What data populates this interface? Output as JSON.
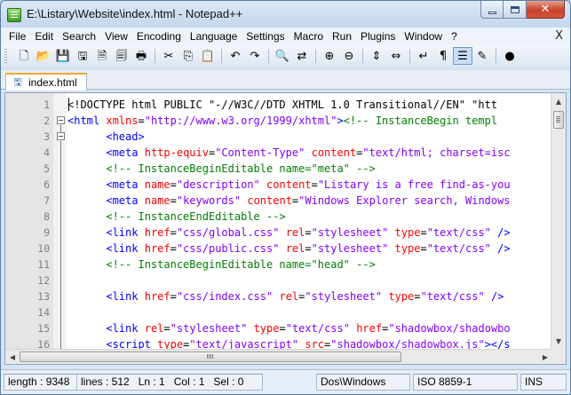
{
  "window": {
    "title": "E:\\Listary\\Website\\index.html - Notepad++"
  },
  "menu": {
    "items": [
      "File",
      "Edit",
      "Search",
      "View",
      "Encoding",
      "Language",
      "Settings",
      "Macro",
      "Run",
      "Plugins",
      "Window",
      "?"
    ],
    "close_glyph": "X"
  },
  "toolbar": {
    "buttons": [
      {
        "icon": "new-file-icon",
        "glyph": "🗋"
      },
      {
        "icon": "open-file-icon",
        "glyph": "📂"
      },
      {
        "icon": "save-icon",
        "glyph": "💾"
      },
      {
        "icon": "save-all-icon",
        "glyph": "🖫"
      },
      {
        "icon": "close-icon",
        "glyph": "🗎"
      },
      {
        "icon": "close-all-icon",
        "glyph": "🗐"
      },
      {
        "icon": "print-icon",
        "glyph": "🖶"
      },
      {
        "icon": "cut-icon",
        "glyph": "✂"
      },
      {
        "icon": "copy-icon",
        "glyph": "⎘"
      },
      {
        "icon": "paste-icon",
        "glyph": "📋"
      },
      {
        "icon": "undo-icon",
        "glyph": "↶"
      },
      {
        "icon": "redo-icon",
        "glyph": "↷"
      },
      {
        "icon": "find-icon",
        "glyph": "🔍"
      },
      {
        "icon": "replace-icon",
        "glyph": "⇄"
      },
      {
        "icon": "zoom-in-icon",
        "glyph": "⊕"
      },
      {
        "icon": "zoom-out-icon",
        "glyph": "⊖"
      },
      {
        "icon": "sync-vertical-icon",
        "glyph": "⇕"
      },
      {
        "icon": "sync-horizontal-icon",
        "glyph": "⇔"
      },
      {
        "icon": "word-wrap-icon",
        "glyph": "↵"
      },
      {
        "icon": "show-all-characters-icon",
        "glyph": "¶"
      },
      {
        "icon": "indent-guide-icon",
        "glyph": "☰",
        "active": true
      },
      {
        "icon": "user-language-icon",
        "glyph": "✎"
      },
      {
        "icon": "record-macro-icon",
        "glyph": "●"
      }
    ]
  },
  "tab": {
    "label": "index.html"
  },
  "editor": {
    "lines": [
      {
        "n": "1",
        "fold": "",
        "tokens": [
          [
            "t-doc",
            "<!DOCTYPE html PUBLIC \"-//W3C//DTD XHTML 1.0 Transitional//EN\" \"htt"
          ]
        ]
      },
      {
        "n": "2",
        "fold": "box",
        "tokens": [
          [
            "t-tag",
            "<html "
          ],
          [
            "t-attr",
            "xmlns"
          ],
          [
            "t-txt",
            "="
          ],
          [
            "t-val",
            "\"http://www.w3.org/1999/xhtml\""
          ],
          [
            "t-tag",
            ">"
          ],
          [
            "t-com",
            "<!-- InstanceBegin templ"
          ]
        ]
      },
      {
        "n": "3",
        "fold": "box",
        "tokens": [
          [
            "t-txt",
            "      "
          ],
          [
            "t-tag",
            "<head>"
          ]
        ]
      },
      {
        "n": "4",
        "fold": "",
        "tokens": [
          [
            "t-txt",
            "      "
          ],
          [
            "t-tag",
            "<meta "
          ],
          [
            "t-attr",
            "http-equiv"
          ],
          [
            "t-txt",
            "="
          ],
          [
            "t-val",
            "\"Content-Type\""
          ],
          [
            "t-txt",
            " "
          ],
          [
            "t-attr",
            "content"
          ],
          [
            "t-txt",
            "="
          ],
          [
            "t-val",
            "\"text/html; charset=isc"
          ]
        ]
      },
      {
        "n": "5",
        "fold": "",
        "tokens": [
          [
            "t-txt",
            "      "
          ],
          [
            "t-com",
            "<!-- InstanceBeginEditable name=\"meta\" -->"
          ]
        ]
      },
      {
        "n": "6",
        "fold": "",
        "tokens": [
          [
            "t-txt",
            "      "
          ],
          [
            "t-tag",
            "<meta "
          ],
          [
            "t-attr",
            "name"
          ],
          [
            "t-txt",
            "="
          ],
          [
            "t-val",
            "\"description\""
          ],
          [
            "t-txt",
            " "
          ],
          [
            "t-attr",
            "content"
          ],
          [
            "t-txt",
            "="
          ],
          [
            "t-val",
            "\"Listary is a free find-as-you"
          ]
        ]
      },
      {
        "n": "7",
        "fold": "",
        "tokens": [
          [
            "t-txt",
            "      "
          ],
          [
            "t-tag",
            "<meta "
          ],
          [
            "t-attr",
            "name"
          ],
          [
            "t-txt",
            "="
          ],
          [
            "t-val",
            "\"keywords\""
          ],
          [
            "t-txt",
            " "
          ],
          [
            "t-attr",
            "content"
          ],
          [
            "t-txt",
            "="
          ],
          [
            "t-val",
            "\"Windows Explorer search, Windows"
          ]
        ]
      },
      {
        "n": "8",
        "fold": "",
        "tokens": [
          [
            "t-txt",
            "      "
          ],
          [
            "t-com",
            "<!-- InstanceEndEditable -->"
          ]
        ]
      },
      {
        "n": "9",
        "fold": "",
        "tokens": [
          [
            "t-txt",
            "      "
          ],
          [
            "t-tag",
            "<link "
          ],
          [
            "t-attr",
            "href"
          ],
          [
            "t-txt",
            "="
          ],
          [
            "t-val",
            "\"css/global.css\""
          ],
          [
            "t-txt",
            " "
          ],
          [
            "t-attr",
            "rel"
          ],
          [
            "t-txt",
            "="
          ],
          [
            "t-val",
            "\"stylesheet\""
          ],
          [
            "t-txt",
            " "
          ],
          [
            "t-attr",
            "type"
          ],
          [
            "t-txt",
            "="
          ],
          [
            "t-val",
            "\"text/css\""
          ],
          [
            "t-txt",
            " "
          ],
          [
            "t-tag",
            "/>"
          ]
        ]
      },
      {
        "n": "10",
        "fold": "",
        "tokens": [
          [
            "t-txt",
            "      "
          ],
          [
            "t-tag",
            "<link "
          ],
          [
            "t-attr",
            "href"
          ],
          [
            "t-txt",
            "="
          ],
          [
            "t-val",
            "\"css/public.css\""
          ],
          [
            "t-txt",
            " "
          ],
          [
            "t-attr",
            "rel"
          ],
          [
            "t-txt",
            "="
          ],
          [
            "t-val",
            "\"stylesheet\""
          ],
          [
            "t-txt",
            " "
          ],
          [
            "t-attr",
            "type"
          ],
          [
            "t-txt",
            "="
          ],
          [
            "t-val",
            "\"text/css\""
          ],
          [
            "t-txt",
            " "
          ],
          [
            "t-tag",
            "/>"
          ]
        ]
      },
      {
        "n": "11",
        "fold": "",
        "tokens": [
          [
            "t-txt",
            "      "
          ],
          [
            "t-com",
            "<!-- InstanceBeginEditable name=\"head\" -->"
          ]
        ]
      },
      {
        "n": "12",
        "fold": "",
        "tokens": []
      },
      {
        "n": "13",
        "fold": "",
        "tokens": [
          [
            "t-txt",
            "      "
          ],
          [
            "t-tag",
            "<link "
          ],
          [
            "t-attr",
            "href"
          ],
          [
            "t-txt",
            "="
          ],
          [
            "t-val",
            "\"css/index.css\""
          ],
          [
            "t-txt",
            " "
          ],
          [
            "t-attr",
            "rel"
          ],
          [
            "t-txt",
            "="
          ],
          [
            "t-val",
            "\"stylesheet\""
          ],
          [
            "t-txt",
            " "
          ],
          [
            "t-attr",
            "type"
          ],
          [
            "t-txt",
            "="
          ],
          [
            "t-val",
            "\"text/css\""
          ],
          [
            "t-txt",
            " "
          ],
          [
            "t-tag",
            "/>"
          ]
        ]
      },
      {
        "n": "14",
        "fold": "",
        "tokens": []
      },
      {
        "n": "15",
        "fold": "",
        "tokens": [
          [
            "t-txt",
            "      "
          ],
          [
            "t-tag",
            "<link "
          ],
          [
            "t-attr",
            "rel"
          ],
          [
            "t-txt",
            "="
          ],
          [
            "t-val",
            "\"stylesheet\""
          ],
          [
            "t-txt",
            " "
          ],
          [
            "t-attr",
            "type"
          ],
          [
            "t-txt",
            "="
          ],
          [
            "t-val",
            "\"text/css\""
          ],
          [
            "t-txt",
            " "
          ],
          [
            "t-attr",
            "href"
          ],
          [
            "t-txt",
            "="
          ],
          [
            "t-val",
            "\"shadowbox/shadowbo"
          ]
        ]
      },
      {
        "n": "16",
        "fold": "",
        "tokens": [
          [
            "t-txt",
            "      "
          ],
          [
            "t-tag",
            "<script "
          ],
          [
            "t-attr",
            "type"
          ],
          [
            "t-txt",
            "="
          ],
          [
            "t-val",
            "\"text/javascript\""
          ],
          [
            "t-txt",
            " "
          ],
          [
            "t-attr",
            "src"
          ],
          [
            "t-txt",
            "="
          ],
          [
            "t-val",
            "\"shadowbox/shadowbox.js\""
          ],
          [
            "t-tag",
            "></s"
          ]
        ]
      }
    ]
  },
  "status": {
    "length": "length : 9348",
    "lines": "lines : 512",
    "ln": "Ln : 1",
    "col": "Col : 1",
    "sel": "Sel : 0",
    "eol": "Dos\\Windows",
    "encoding": "ISO 8859-1",
    "mode": "INS"
  }
}
